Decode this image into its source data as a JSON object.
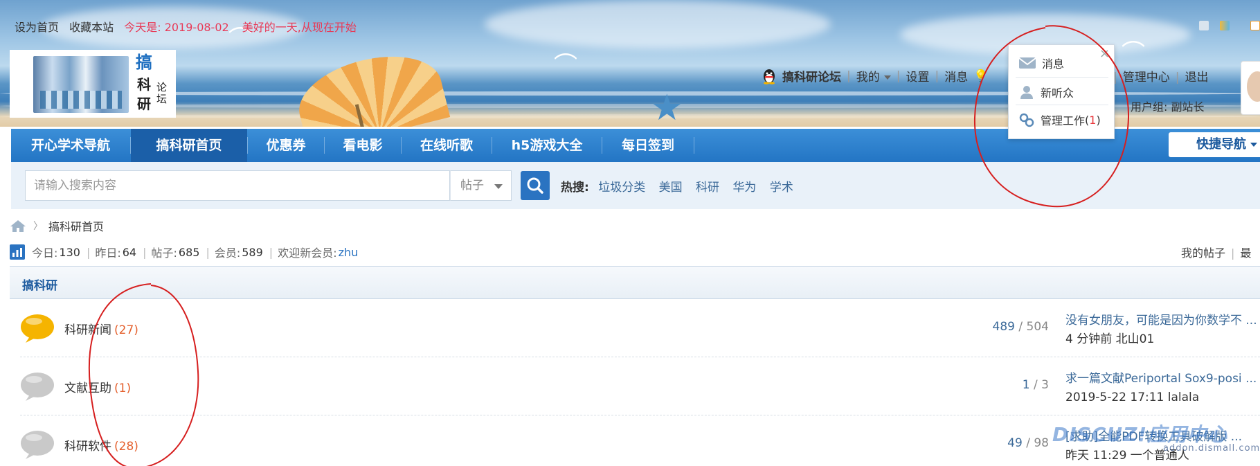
{
  "top_bar": {
    "set_home": "设为首页",
    "bookmark": "收藏本站",
    "today": "今天是: 2019-08-02",
    "slogan": "美好的一天,从现在开始"
  },
  "logo": {
    "char1": "搞",
    "char2": "科",
    "char3": "研",
    "char4": "论坛"
  },
  "user_nav": {
    "username": "搞科研论坛",
    "my": "我的",
    "settings": "设置",
    "messages": "消息",
    "partial": "理",
    "admin_center": "管理中心",
    "logout": "退出",
    "user_group": "用户组: 副站长"
  },
  "popup": {
    "close": "×",
    "items": [
      {
        "label": "消息",
        "count": ""
      },
      {
        "label": "新听众",
        "count": ""
      },
      {
        "label": "管理工作",
        "count": "1"
      }
    ]
  },
  "main_nav": {
    "items": [
      {
        "label": "开心学术导航"
      },
      {
        "label": "搞科研首页"
      },
      {
        "label": "优惠券"
      },
      {
        "label": "看电影"
      },
      {
        "label": "在线听歌"
      },
      {
        "label": "h5游戏大全"
      },
      {
        "label": "每日签到"
      }
    ],
    "active_index": 1,
    "quick_nav": "快捷导航"
  },
  "search": {
    "placeholder": "请输入搜索内容",
    "type": "帖子",
    "hot_label": "热搜:",
    "hot_terms": [
      "垃圾分类",
      "美国",
      "科研",
      "华为",
      "学术"
    ]
  },
  "breadcrumb": {
    "current": "搞科研首页"
  },
  "stats": {
    "today_label": "今日:",
    "today": "130",
    "yesterday_label": "昨日:",
    "yesterday": "64",
    "posts_label": "帖子:",
    "posts": "685",
    "members_label": "会员:",
    "members": "589",
    "welcome_label": "欢迎新会员:",
    "newest_member": "zhu",
    "my_posts": "我的帖子",
    "latest": "最"
  },
  "section": {
    "title": "搞科研"
  },
  "forums": [
    {
      "name": "科研新闻",
      "today": "(27)",
      "threads": "489",
      "posts": "504",
      "last_title": "没有女朋友，可能是因为你数学不 ...",
      "last_meta": "4 分钟前 北山01",
      "icon_color": "#f5b400"
    },
    {
      "name": "文献互助",
      "today": "(1)",
      "threads": "1",
      "posts": "3",
      "last_title": "求一篇文献Periportal Sox9-posi ...",
      "last_meta": "2019-5-22 17:11 lalala",
      "icon_color": "#c9c9c9"
    },
    {
      "name": "科研软件",
      "today": "(28)",
      "threads": "49",
      "posts": "98",
      "last_title": "[求助]全能PDF转换工具破解版 ...",
      "last_meta": "昨天 11:29 一个普通人",
      "icon_color": "#c9c9c9"
    }
  ],
  "watermark": {
    "brand": "DISCUZ!应用中心",
    "url": "addon.dismall.com"
  }
}
